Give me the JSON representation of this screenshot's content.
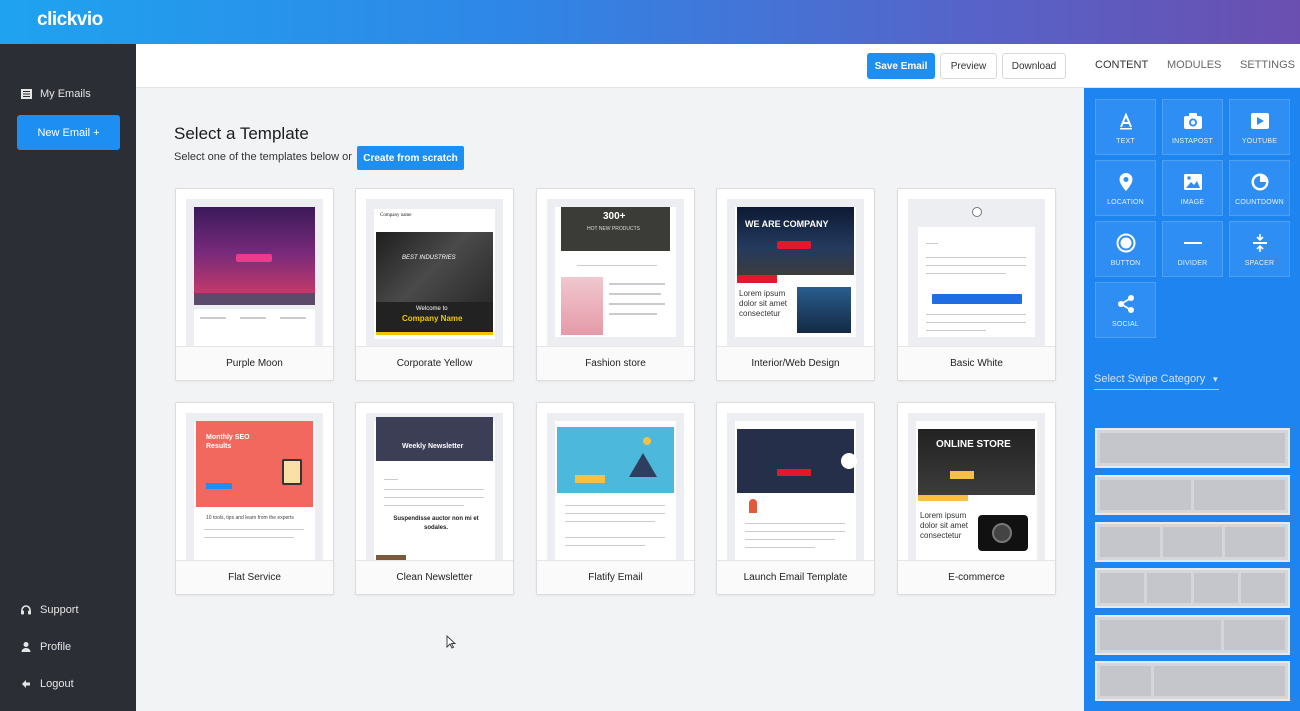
{
  "app": {
    "logo": "clickvio"
  },
  "sidebar": {
    "my_emails": "My Emails",
    "new_email": "New Email +",
    "support": "Support",
    "profile": "Profile",
    "logout": "Logout"
  },
  "toolbar": {
    "save": "Save Email",
    "preview": "Preview",
    "download": "Download"
  },
  "main": {
    "title": "Select a Template",
    "subtitle": "Select one of the templates below or",
    "create_scratch": "Create from scratch"
  },
  "templates": [
    {
      "name": "Purple Moon"
    },
    {
      "name": "Corporate Yellow"
    },
    {
      "name": "Fashion store"
    },
    {
      "name": "Interior/Web Design"
    },
    {
      "name": "Basic White"
    },
    {
      "name": "Flat Service"
    },
    {
      "name": "Clean Newsletter"
    },
    {
      "name": "Flatify Email"
    },
    {
      "name": "Launch Email Template"
    },
    {
      "name": "E-commerce"
    }
  ],
  "thumb_text": {
    "corporate_company": "Company name",
    "corporate_best": "BEST INDUSTRIES",
    "corporate_welcome": "Welcome to",
    "corporate_company2": "Company Name",
    "fashion_big": "300+",
    "fashion_sub": "HOT NEW PRODUCTS",
    "interior_title": "WE ARE COMPANY",
    "interior_lorem": "Lorem ipsum dolor sit amet consectetur",
    "flat_title": "Monthly SEO Results",
    "flat_body": "10 tools, tips and learn from the experts",
    "clean_title": "Weekly Newsletter",
    "clean_body": "Suspendisse auctor non mi et sodales.",
    "ecom_title": "ONLINE STORE",
    "ecom_lorem": "Lorem ipsum dolor sit amet consectetur"
  },
  "right_panel": {
    "tabs": [
      "CONTENT",
      "MODULES",
      "SETTINGS"
    ],
    "modules": [
      {
        "label": "TEXT",
        "icon": "text-icon"
      },
      {
        "label": "INSTAPOST",
        "icon": "camera-icon"
      },
      {
        "label": "YOUTUBE",
        "icon": "video-icon"
      },
      {
        "label": "LOCATION",
        "icon": "location-pin-icon"
      },
      {
        "label": "IMAGE",
        "icon": "image-icon"
      },
      {
        "label": "COUNTDOWN",
        "icon": "clock-icon"
      },
      {
        "label": "BUTTON",
        "icon": "circle-button-icon"
      },
      {
        "label": "DIVIDER",
        "icon": "divider-icon"
      },
      {
        "label": "SPACER",
        "icon": "spacer-icon"
      },
      {
        "label": "SOCIAL",
        "icon": "share-icon"
      }
    ],
    "swipe_label": "Select Swipe Category"
  },
  "colors": {
    "accent": "#1e8ff2",
    "sidebar": "#2c2e36",
    "panel": "#1d84f0"
  }
}
